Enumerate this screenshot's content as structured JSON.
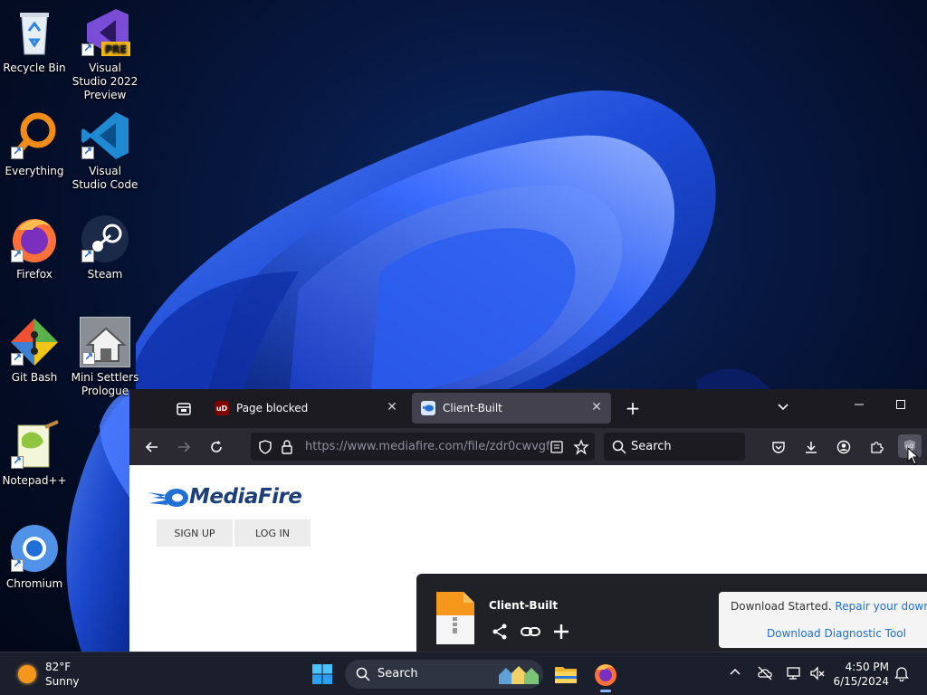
{
  "desktop": {
    "icons": [
      {
        "label": "Recycle Bin",
        "icon": "recycle-bin-icon"
      },
      {
        "label": "Visual Studio 2022 Preview",
        "icon": "visual-studio-preview-icon",
        "badge": "PRE"
      },
      {
        "label": "Everything",
        "icon": "everything-search-icon"
      },
      {
        "label": "Visual Studio Code",
        "icon": "vscode-icon"
      },
      {
        "label": "Firefox",
        "icon": "firefox-icon"
      },
      {
        "label": "Steam",
        "icon": "steam-icon"
      },
      {
        "label": "Git Bash",
        "icon": "git-bash-icon"
      },
      {
        "label": "Mini Settlers Prologue",
        "icon": "mini-settlers-icon"
      },
      {
        "label": "Notepad++",
        "icon": "notepad-plus-plus-icon"
      },
      {
        "label": "Chromium",
        "icon": "chromium-icon"
      }
    ]
  },
  "browser": {
    "tabs": [
      {
        "title": "Page blocked",
        "favicon": "ublock-icon",
        "active": false
      },
      {
        "title": "Client-Built",
        "favicon": "mediafire-icon",
        "active": true
      }
    ],
    "url": "https://www.mediafire.com/file/zdr0cwvgf",
    "search_placeholder": "Search",
    "colors": {
      "chrome": "#1c1b22",
      "toolbar": "#2b2a33",
      "active_tab": "#42414d"
    }
  },
  "page": {
    "brand": "MediaFire",
    "signup_label": "SIGN UP",
    "login_label": "LOG IN",
    "download": {
      "file_name": "Client-Built",
      "toast_text": "Download Started.",
      "toast_link": "Repair your download",
      "diagnostic_link": "Download Diagnostic Tool"
    },
    "colors": {
      "brand_blue": "#1c3f78",
      "link": "#1f6fd6"
    }
  },
  "taskbar": {
    "weather_temp": "82°F",
    "weather_condition": "Sunny",
    "search_placeholder": "Search",
    "time": "4:50 PM",
    "date": "6/15/2024"
  }
}
